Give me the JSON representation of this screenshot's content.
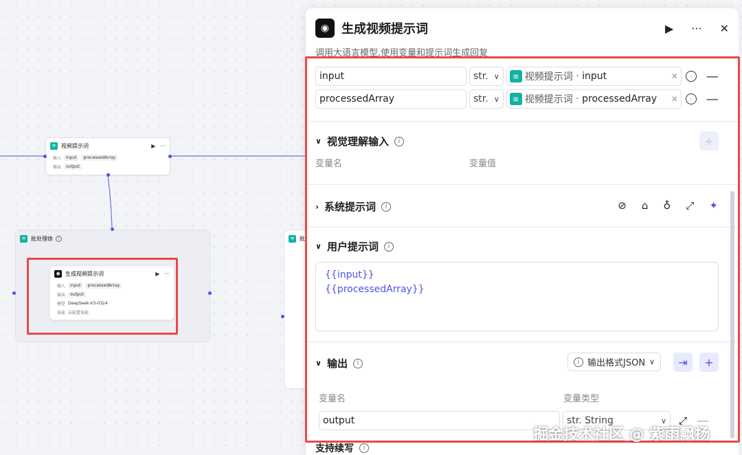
{
  "canvas": {
    "node_video": {
      "title": "视频提示词",
      "input_label": "输入",
      "input_chips": [
        "input",
        "processedArray"
      ],
      "output_label": "输出",
      "output_chips": [
        "output"
      ]
    },
    "batch_group": {
      "title": "批处理体",
      "partial_title": "批"
    },
    "node_gen": {
      "title": "生成视频提示词",
      "input_label": "输入",
      "input_chips": [
        "input",
        "processedArray"
      ],
      "output_label": "输出",
      "output_chips": [
        "output"
      ],
      "model_label": "模型",
      "model": "DeepSeek-V3-0324",
      "skill_label": "技能",
      "skill": "未配置技能"
    }
  },
  "panel": {
    "title": "生成视频提示词",
    "description": "调用大语言模型,使用变量和提示词生成回复",
    "inputs": [
      {
        "name": "input",
        "type": "str.",
        "ref_source": "视频提示词",
        "ref_var": "input"
      },
      {
        "name": "processedArray",
        "type": "str.",
        "ref_source": "视频提示词",
        "ref_var": "processedArray"
      }
    ],
    "vision": {
      "title": "视觉理解输入",
      "col_name": "变量名",
      "col_value": "变量值"
    },
    "system_prompt": {
      "title": "系统提示词"
    },
    "user_prompt": {
      "title": "用户提示词",
      "lines": [
        "{{input}}",
        "{{processedArray}}"
      ]
    },
    "output": {
      "title": "输出",
      "format_label": "输出格式JSON",
      "col_name": "变量名",
      "col_type": "变量类型",
      "var_name": "output",
      "var_type": "str. String"
    },
    "stream": {
      "title": "支持续写"
    }
  },
  "watermark": "掘金技术社区 @ 紫雨飘扬",
  "colors": {
    "accent": "#4d53e8",
    "teal": "#10b3a3",
    "highlight": "#e94848"
  }
}
